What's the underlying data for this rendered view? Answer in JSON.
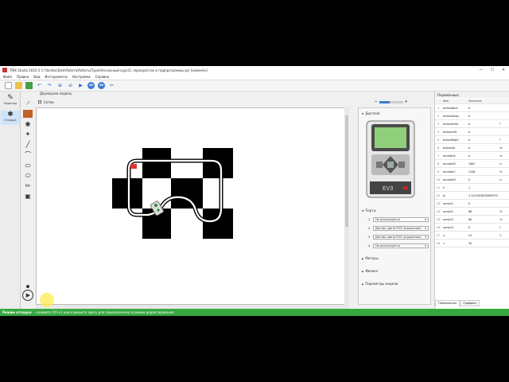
{
  "window": {
    "title": "TRIK Studio 2020.5 C:\\Yandex\\Disk\\Работа\\Роботы\\Трик\\Начальный курс\\5. перекрёсток и подпрограммы.qrs [изменён]",
    "minimize": "—",
    "maximize": "☐",
    "close": "✕"
  },
  "menu": [
    "Файл",
    "Правка",
    "Вид",
    "Инструменты",
    "Настройки",
    "Справка"
  ],
  "toolbar": {
    "mode_2d": "2D",
    "mode_3d": "3D"
  },
  "modes": {
    "editor_label": "Редактор",
    "debug_label": "Отладка"
  },
  "world": {
    "header": "Двумерная модель",
    "grid_label": "Сетка",
    "zoom_minus": "−",
    "zoom_plus": "+",
    "zoom_fraction": 0.45
  },
  "robot_panel": {
    "display_label": "Дисплей",
    "ev3_brand": "EV3",
    "ports_label": "Порты",
    "ports": [
      {
        "port": "1",
        "value": "Не используется"
      },
      {
        "port": "2",
        "value": "Датчик цвета EV3 (отражение)"
      },
      {
        "port": "3",
        "value": "Датчик цвета EV3 (отражение)"
      },
      {
        "port": "4",
        "value": "Не используется"
      }
    ],
    "motors_label": "Моторы",
    "physics_label": "Физика",
    "params_label": "Параметры модели"
  },
  "variables": {
    "header": "Переменные",
    "columns": [
      "Имя",
      "Значение",
      ""
    ],
    "rows": [
      {
        "n": "1",
        "name": "buttonBack",
        "value": "0",
        "extra": ""
      },
      {
        "n": "2",
        "name": "buttonDown",
        "value": "0",
        "extra": ""
      },
      {
        "n": "3",
        "name": "buttonEnter",
        "value": "0",
        "extra": "Т"
      },
      {
        "n": "4",
        "name": "buttonLeft",
        "value": "0",
        "extra": ""
      },
      {
        "n": "5",
        "name": "buttonRight",
        "value": "0",
        "extra": "Т"
      },
      {
        "n": "6",
        "name": "buttonUp",
        "value": "0",
        "extra": "Ve"
      },
      {
        "n": "7",
        "name": "encoderA",
        "value": "0",
        "extra": "ze"
      },
      {
        "n": "8",
        "name": "encoderB",
        "value": "1861",
        "extra": "er"
      },
      {
        "n": "9",
        "name": "encoderC",
        "value": "2108",
        "extra": "Te"
      },
      {
        "n": "10",
        "name": "encoderD",
        "value": "0",
        "extra": "er"
      },
      {
        "n": "11",
        "name": "k",
        "value": "1",
        "extra": ""
      },
      {
        "n": "12",
        "name": "pi",
        "value": "3.1415926535898793",
        "extra": ""
      },
      {
        "n": "13",
        "name": "sensor1",
        "value": "0",
        "extra": ""
      },
      {
        "n": "14",
        "name": "sensor2",
        "value": "86",
        "extra": "Te"
      },
      {
        "n": "15",
        "name": "sensor3",
        "value": "80",
        "extra": "Te"
      },
      {
        "n": "16",
        "name": "sensor4",
        "value": "0",
        "extra": "С"
      },
      {
        "n": "17",
        "name": "u",
        "value": "25",
        "extra": "Л"
      },
      {
        "n": "18",
        "name": "v",
        "value": "30",
        "extra": ""
      }
    ],
    "tab_vars": "Переменные",
    "tab_graphs": "Графики"
  },
  "status": {
    "mode": "Режим отладки",
    "text": "- нажмите Ctrl+1 или кликните здесь для переключения в режим редактирования"
  },
  "colors": {
    "status_bg": "#38a840",
    "accent": "#3a7bd5",
    "ev3_screen": "#8fce7a"
  },
  "icons": {
    "file_new": "new-file-icon",
    "file_open": "open-folder-icon",
    "save": "save-icon",
    "undo": "undo-icon",
    "redo": "redo-icon",
    "zoom_in": "zoom-in-icon",
    "zoom_out": "zoom-out-icon",
    "run": "run-icon",
    "stop": "stop-icon",
    "settings": "tools-icon"
  }
}
